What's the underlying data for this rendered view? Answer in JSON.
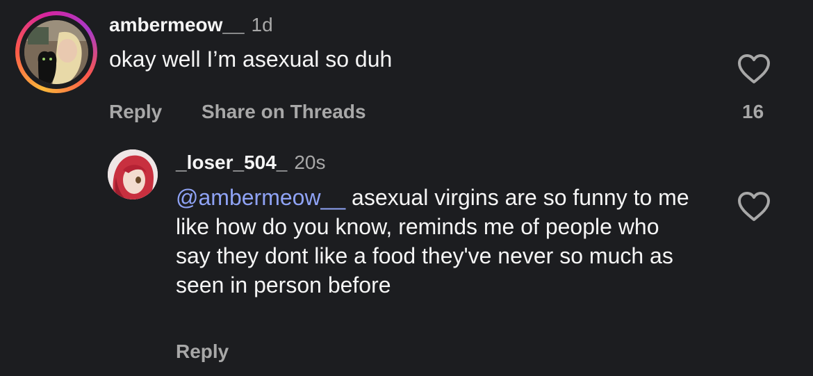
{
  "comments": [
    {
      "username": "ambermeow__",
      "time": "1d",
      "text": "okay well I’m asexual so duh",
      "reply_label": "Reply",
      "share_label": "Share on Threads",
      "like_count": "16"
    },
    {
      "username": "_loser_504_",
      "time": "20s",
      "mention": "@ambermeow__",
      "text": " asexual virgins are so funny to me like how do you know, reminds me of people who say they dont like a food they've never so much as seen in person before",
      "reply_label": "Reply"
    }
  ],
  "icons": {
    "like": "heart-outline-icon"
  },
  "colors": {
    "background": "#1c1d20",
    "text": "#f5f5f5",
    "secondary_text": "#a8a8a8",
    "mention": "#8fa3f5"
  }
}
